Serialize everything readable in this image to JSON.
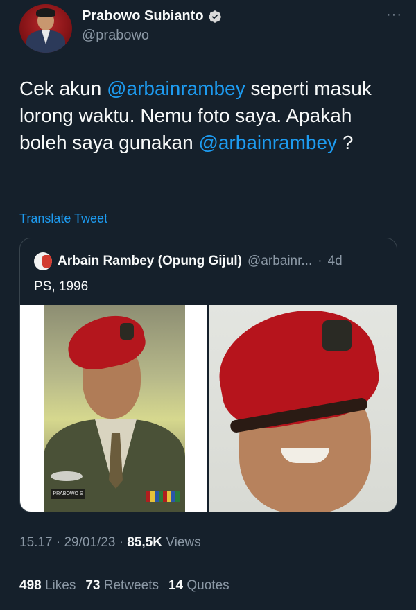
{
  "tweet": {
    "author": {
      "name": "Prabowo Subianto",
      "handle": "@prabowo",
      "verified": true
    },
    "text_parts": {
      "p1": "Cek akun ",
      "m1": "@arbainrambey",
      "p2": " seperti masuk lorong waktu. Nemu foto saya. Apakah boleh saya gunakan ",
      "m2": "@arbainrambey",
      "p3": " ?"
    },
    "translate_label": "Translate Tweet",
    "more_icon": "···",
    "colors": {
      "background": "#15202b",
      "link": "#1d9bf0",
      "muted": "#8b98a5",
      "text": "#f7f9f9"
    }
  },
  "quoted": {
    "name": "Arbain Rambey (Opung Gijul)",
    "handle": "@arbainr...",
    "separator": "·",
    "time": "4d",
    "text": "PS, 1996",
    "photo_tag": "PRABOWO S"
  },
  "meta": {
    "time": "15.17",
    "sep1": "·",
    "date": "29/01/23",
    "sep2": "·",
    "views_count": "85,5K",
    "views_label": "Views"
  },
  "stats": {
    "likes_count": "498",
    "likes_label": "Likes",
    "retweets_count": "73",
    "retweets_label": "Retweets",
    "quotes_count": "14",
    "quotes_label": "Quotes"
  }
}
